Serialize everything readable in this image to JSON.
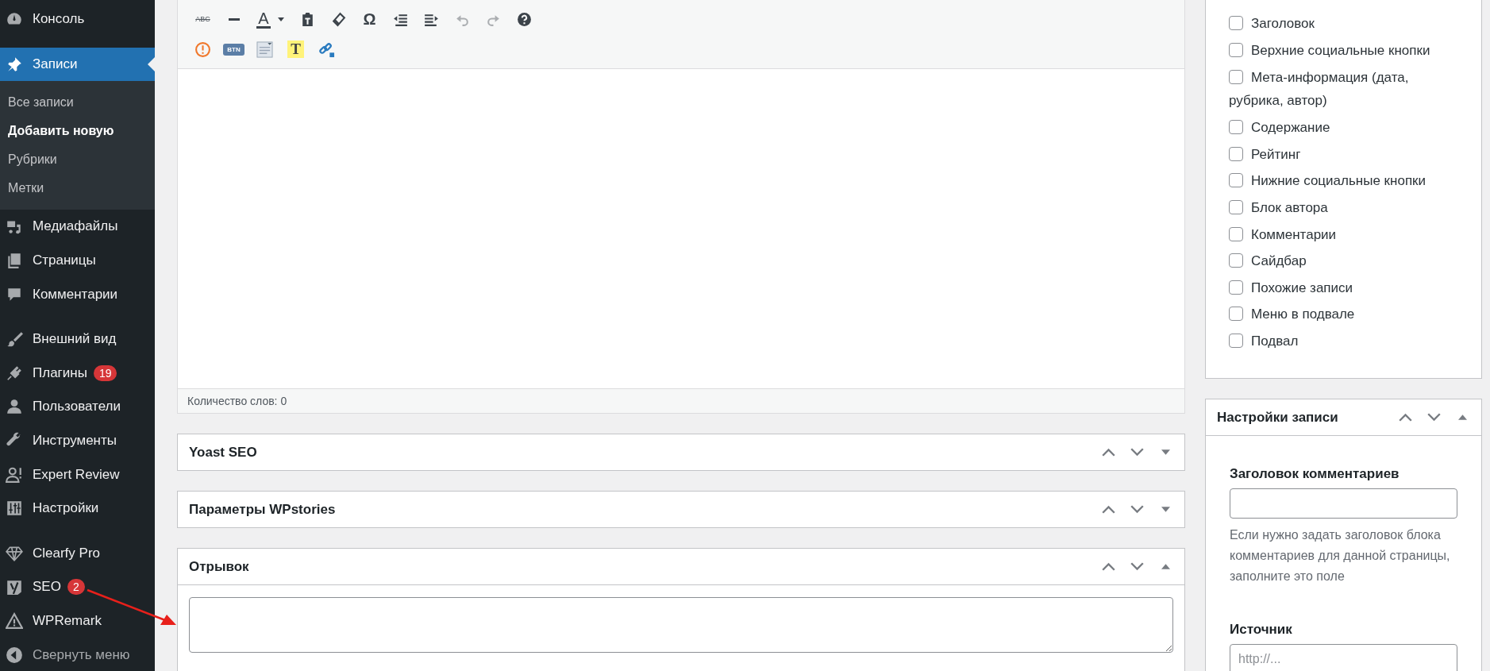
{
  "sidebar": {
    "groups": [
      {
        "items": [
          {
            "label": "Консоль",
            "selected": false
          }
        ]
      },
      {
        "items": [
          {
            "label": "Записи",
            "selected": true,
            "children": [
              {
                "label": "Все записи",
                "selected": false
              },
              {
                "label": "Добавить новую",
                "selected": true
              },
              {
                "label": "Рубрики",
                "selected": false
              },
              {
                "label": "Метки",
                "selected": false
              }
            ]
          },
          {
            "label": "Медиафайлы",
            "selected": false
          },
          {
            "label": "Страницы",
            "selected": false
          },
          {
            "label": "Комментарии",
            "selected": false
          }
        ]
      },
      {
        "items": [
          {
            "label": "Внешний вид",
            "selected": false
          },
          {
            "label": "Плагины",
            "selected": false,
            "badge": "19"
          },
          {
            "label": "Пользователи",
            "selected": false
          },
          {
            "label": "Инструменты",
            "selected": false
          },
          {
            "label": "Expert Review",
            "selected": false
          },
          {
            "label": "Настройки",
            "selected": false
          }
        ]
      },
      {
        "items": [
          {
            "label": "Clearfy Pro",
            "selected": false
          },
          {
            "label": "SEO",
            "selected": false,
            "badge": "2"
          },
          {
            "label": "WPRemark",
            "selected": false
          }
        ]
      }
    ],
    "collapse": {
      "label": "Свернуть меню"
    }
  },
  "editor": {
    "toolbar": [
      [
        {
          "kind": "strikethrough",
          "glyph": "ABC",
          "disabled": false
        },
        {
          "kind": "horizontal-line",
          "disabled": false
        },
        {
          "kind": "text-color",
          "glyph": "A",
          "disabled": false
        },
        {
          "kind": "paste-text",
          "disabled": false
        },
        {
          "kind": "clear-formatting",
          "disabled": false
        },
        {
          "kind": "special-character",
          "glyph": "Ω",
          "disabled": false
        },
        {
          "kind": "outdent",
          "disabled": false
        },
        {
          "kind": "indent",
          "disabled": false
        },
        {
          "kind": "undo",
          "disabled": true
        },
        {
          "kind": "redo",
          "disabled": true
        },
        {
          "kind": "help",
          "disabled": false
        }
      ],
      [
        {
          "kind": "warning",
          "disabled": false
        },
        {
          "kind": "button-shortcode",
          "glyph": "BTN",
          "disabled": false
        },
        {
          "kind": "template",
          "disabled": false
        },
        {
          "kind": "highlight",
          "glyph": "T",
          "disabled": false
        },
        {
          "kind": "external-link",
          "disabled": false
        }
      ]
    ],
    "word_count": "Количество слов: 0"
  },
  "metaboxes": [
    {
      "title": "Yoast SEO",
      "expanded": false
    },
    {
      "title": "Параметры WPstories",
      "expanded": false
    },
    {
      "title": "Отрывок",
      "expanded": true
    }
  ],
  "right": {
    "checklist": [
      {
        "label": "Заголовок",
        "checked": false
      },
      {
        "label": "Верхние социальные кнопки",
        "checked": false
      },
      {
        "label": "Мета-информация (дата, рубрика, автор)",
        "checked": false
      },
      {
        "label": "Содержание",
        "checked": false
      },
      {
        "label": "Рейтинг",
        "checked": false
      },
      {
        "label": "Нижние социальные кнопки",
        "checked": false
      },
      {
        "label": "Блок автора",
        "checked": false
      },
      {
        "label": "Комментарии",
        "checked": false
      },
      {
        "label": "Сайдбар",
        "checked": false
      },
      {
        "label": "Похожие записи",
        "checked": false
      },
      {
        "label": "Меню в подвале",
        "checked": false
      },
      {
        "label": "Подвал",
        "checked": false
      }
    ],
    "post_settings": {
      "title": "Настройки записи",
      "expanded": true,
      "fields": [
        {
          "label": "Заголовок комментариев",
          "help": "Если нужно задать заголовок блока комментариев для данной страницы, заполните это поле"
        },
        {
          "label": "Источник",
          "placeholder": "http://..."
        }
      ]
    }
  }
}
